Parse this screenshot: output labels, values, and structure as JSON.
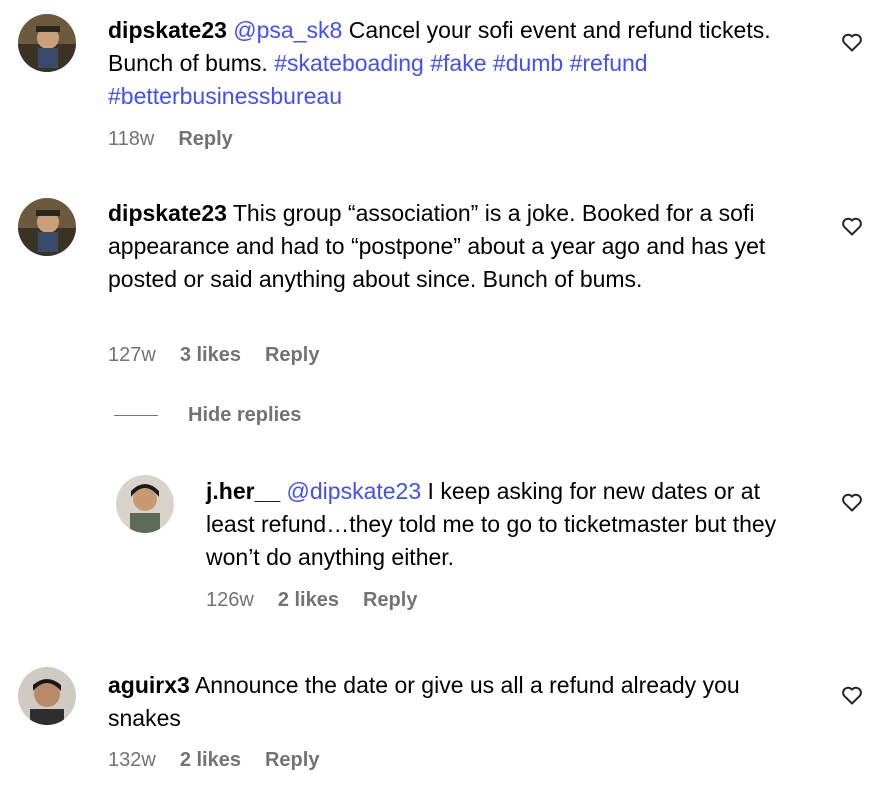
{
  "comments": [
    {
      "username": "dipskate23",
      "mention": "@psa_sk8",
      "text": " Cancel your sofi event and refund tickets. Bunch of bums. ",
      "hashtags": [
        "#skateboading",
        "#fake",
        "#dumb",
        "#refund",
        "#betterbusinessbureau"
      ],
      "time": "118w",
      "likes": "",
      "reply_label": "Reply"
    },
    {
      "username": "dipskate23",
      "text": " This group “association” is a joke. Booked for a sofi appearance and had to “postpone” about a year ago and has yet posted or said anything about since. Bunch of bums.",
      "time": "127w",
      "likes": "3 likes",
      "reply_label": "Reply",
      "hide_replies_label": "Hide replies"
    },
    {
      "username": "j.her__",
      "mention": "@dipskate23",
      "text": " I keep asking for new dates or at least refund…they told me to go to ticketmaster but they won’t do anything either.",
      "time": "126w",
      "likes": "2 likes",
      "reply_label": "Reply"
    },
    {
      "username": "aguirx3",
      "text": " Announce the date or give us all a refund already you snakes",
      "time": "132w",
      "likes": "2 likes",
      "reply_label": "Reply"
    }
  ],
  "icons": {
    "like": "heart-outline-icon",
    "avatar_placeholder": "user-avatar"
  }
}
